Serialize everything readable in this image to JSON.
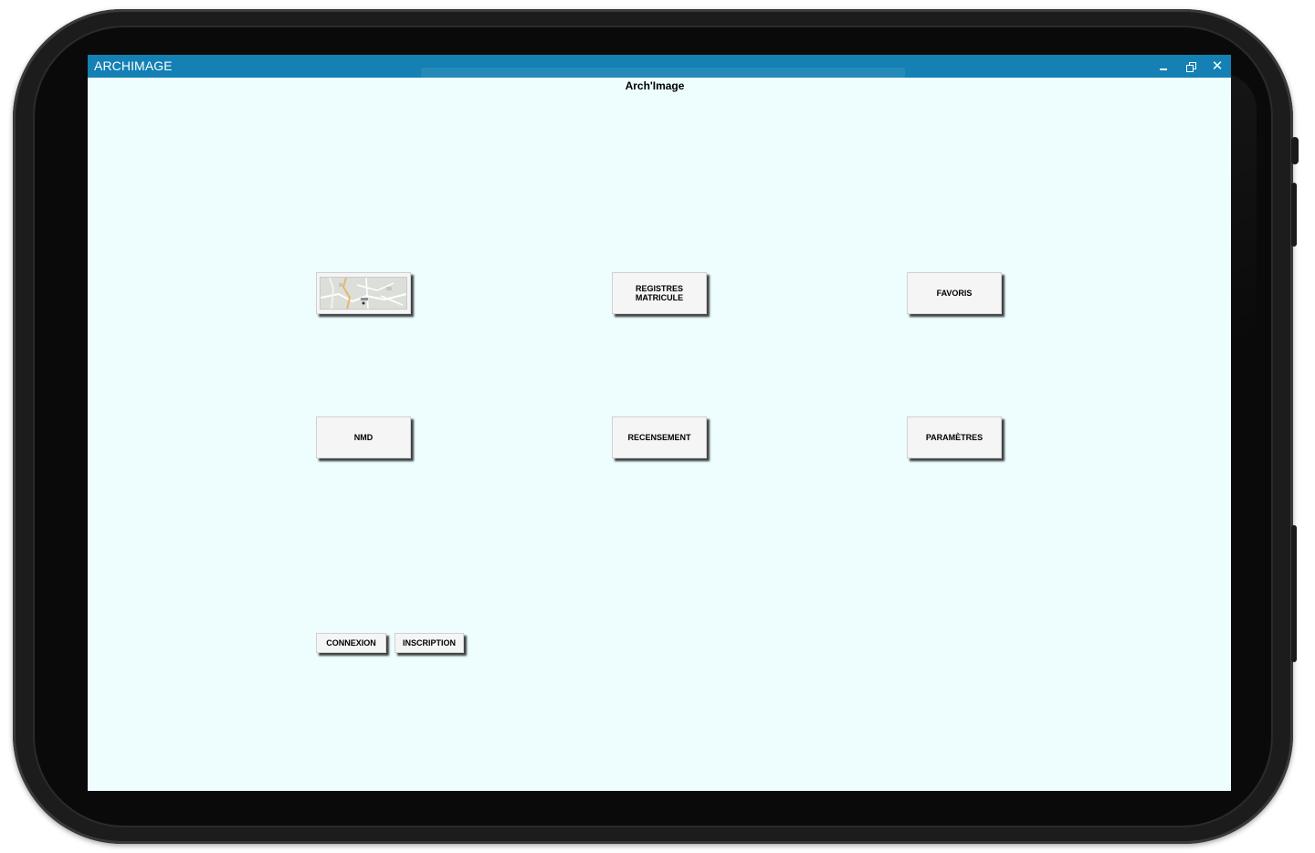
{
  "window": {
    "title": "ARCHIMAGE",
    "controls": {
      "minimize_icon": "minimize-icon",
      "restore_icon": "restore-icon",
      "close_icon": "close-icon"
    },
    "titlebar_color": "#1480b3",
    "background_color": "#eefeff"
  },
  "app": {
    "heading": "Arch'Image"
  },
  "tiles": [
    {
      "label": "",
      "icon": "map-thumbnail"
    },
    {
      "label": "REGISTRES MATRICULE"
    },
    {
      "label": "FAVORIS"
    },
    {
      "label": "NMD"
    },
    {
      "label": "RECENSEMENT"
    },
    {
      "label": "PARAMÈTRES"
    }
  ],
  "auth": {
    "login_label": "CONNEXION",
    "signup_label": "INSCRIPTION"
  }
}
